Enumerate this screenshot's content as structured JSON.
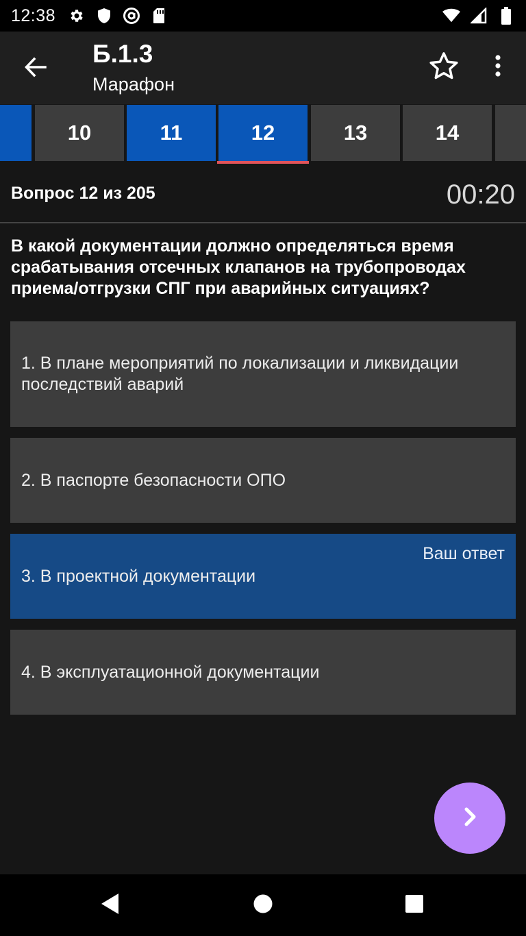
{
  "status": {
    "time": "12:38",
    "left_icons": [
      "settings-icon",
      "shield-icon",
      "at-sign-icon",
      "sd-card-icon"
    ],
    "right_icons": [
      "wifi-icon",
      "cell-signal-icon",
      "battery-icon"
    ]
  },
  "app_bar": {
    "title": "Б.1.3",
    "subtitle": "Марафон",
    "back_icon": "arrow-left-icon",
    "star_icon": "star-outline-icon",
    "more_icon": "more-vertical-icon"
  },
  "tabs": [
    {
      "label": "",
      "style": "blue"
    },
    {
      "label": "10",
      "style": "gray"
    },
    {
      "label": "11",
      "style": "blue"
    },
    {
      "label": "12",
      "style": "blue",
      "selected": true
    },
    {
      "label": "13",
      "style": "gray"
    },
    {
      "label": "14",
      "style": "gray"
    },
    {
      "label": "",
      "style": "gray"
    }
  ],
  "question_header": {
    "counter": "Вопрос 12 из 205",
    "timer": "00:20"
  },
  "question": {
    "text": "В какой документации должно определяться время срабатывания отсечных клапанов на трубопроводах приема/отгрузки СПГ при аварийных ситуациях?"
  },
  "answers": [
    {
      "text": "1. В плане мероприятий по локализации и ликвидации последствий аварий",
      "selected": false
    },
    {
      "text": "2. В паспорте безопасности ОПО",
      "selected": false
    },
    {
      "text": "3. В проектной документации",
      "selected": true,
      "tag": "Ваш ответ"
    },
    {
      "text": "4. В эксплуатационной документации",
      "selected": false
    }
  ],
  "colors": {
    "background": "#161616",
    "app_bar": "#1f1f1f",
    "tab_gray": "#3d3d3d",
    "tab_blue": "#0a57b8",
    "tab_indicator": "#e0535a",
    "answer_bg": "#3d3d3d",
    "answer_selected_bg": "#164a86",
    "fab": "#bb86fc"
  },
  "fab": {
    "icon": "chevron-right-icon"
  },
  "nav": {
    "back_icon": "nav-back-icon",
    "home_icon": "nav-home-icon",
    "recents_icon": "nav-recents-icon"
  }
}
